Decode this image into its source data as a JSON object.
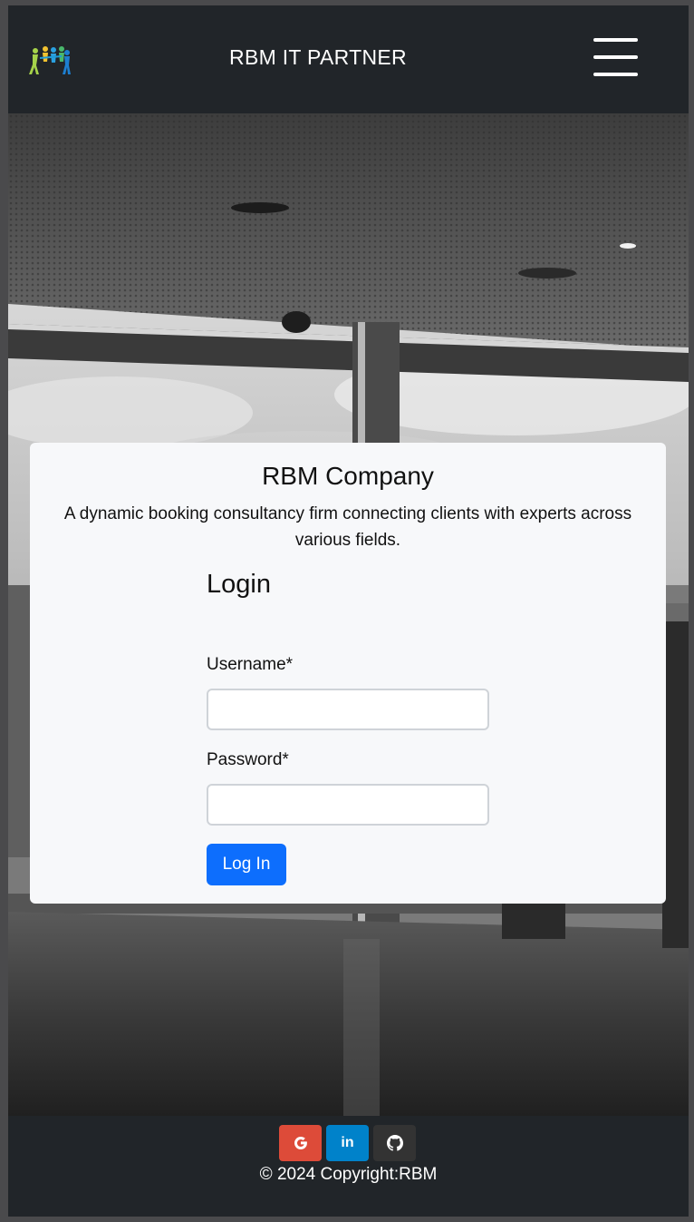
{
  "navbar": {
    "logo_icon": "people-logo-icon",
    "brand": "RBM IT PARTNER",
    "menu_icon": "hamburger-menu-icon"
  },
  "card": {
    "company": "RBM Company",
    "tagline": "A dynamic booking consultancy firm connecting clients with experts across various fields.",
    "login_title": "Login",
    "username_label": "Username*",
    "username_value": "",
    "password_label": "Password*",
    "password_value": "",
    "login_button": "Log In"
  },
  "footer": {
    "social": [
      {
        "icon": "google-icon",
        "glyph": "G",
        "color": "#dd4b39"
      },
      {
        "icon": "linkedin-icon",
        "glyph": "in",
        "color": "#0082ca"
      },
      {
        "icon": "github-icon",
        "glyph": "",
        "color": "#333333"
      }
    ],
    "copyright": "© 2024 Copyright:RBM"
  },
  "colors": {
    "navbar_bg": "#212529",
    "card_bg": "#f7f8fa",
    "primary": "#0d6efd"
  }
}
